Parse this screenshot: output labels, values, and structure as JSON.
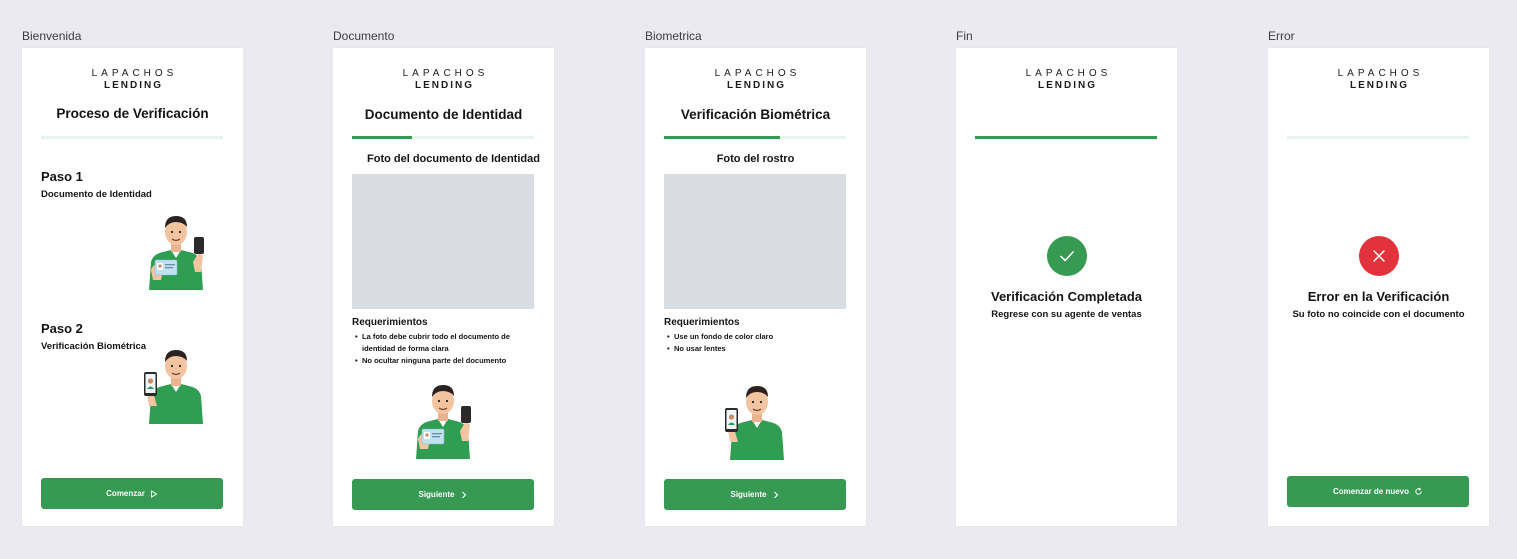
{
  "brand": {
    "top": "LAPACHOS",
    "bottom": "LENDING"
  },
  "colors": {
    "primary": "#369a53",
    "progress_track": "#e7f4ee",
    "error": "#e2323c",
    "placeholder": "#d9dce0"
  },
  "frames": {
    "bienvenida": {
      "label": "Bienvenida",
      "title": "Proceso de Verificación",
      "progress": 0,
      "step1": {
        "title": "Paso 1",
        "subtitle": "Documento de Identidad",
        "icon": "person-with-id-card-illustration"
      },
      "step2": {
        "title": "Paso 2",
        "subtitle": "Verificación Biométrica",
        "icon": "person-with-selfie-phone-illustration"
      },
      "button": {
        "label": "Comenzar",
        "icon": "play-icon"
      }
    },
    "documento": {
      "label": "Documento",
      "title": "Documento de Identidad",
      "progress": 0.33,
      "subheading": "Foto del documento de Identidad",
      "requirements_title": "Requerimientos",
      "requirements": [
        "La foto debe cubrir todo el documento de identidad de forma clara",
        "No ocultar ninguna parte del documento"
      ],
      "button": {
        "label": "Siguiente",
        "icon": "chevron-right-icon"
      }
    },
    "biometrica": {
      "label": "Biometrica",
      "title": "Verificación Biométrica",
      "progress": 0.64,
      "subheading": "Foto del rostro",
      "requirements_title": "Requerimientos",
      "requirements": [
        "Use un fondo de color claro",
        "No usar lentes"
      ],
      "button": {
        "label": "Siguiente",
        "icon": "chevron-right-icon"
      }
    },
    "fin": {
      "label": "Fin",
      "progress": 1,
      "status_title": "Verificación Completada",
      "status_subtitle": "Regrese con su agente de ventas",
      "icon": "check-circle-icon"
    },
    "error": {
      "label": "Error",
      "progress": 0,
      "status_title": "Error en la Verificación",
      "status_subtitle": "Su foto no coincide con el documento",
      "icon": "x-circle-icon",
      "button": {
        "label": "Comenzar de nuevo",
        "icon": "refresh-icon"
      }
    }
  }
}
